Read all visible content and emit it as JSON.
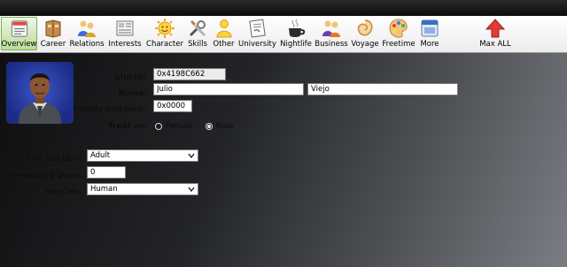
{
  "toolbar": {
    "items": [
      {
        "label": "Overview",
        "icon": "overview-icon",
        "active": true
      },
      {
        "label": "Career",
        "icon": "career-icon"
      },
      {
        "label": "Relations",
        "icon": "relations-icon"
      },
      {
        "label": "Interests",
        "icon": "interests-icon"
      },
      {
        "label": "Character",
        "icon": "character-icon"
      },
      {
        "label": "Skills",
        "icon": "skills-icon"
      },
      {
        "label": "Other",
        "icon": "other-icon"
      },
      {
        "label": "University",
        "icon": "university-icon"
      },
      {
        "label": "Nightlife",
        "icon": "nightlife-icon"
      },
      {
        "label": "Business",
        "icon": "business-icon"
      },
      {
        "label": "Voyage",
        "icon": "voyage-icon"
      },
      {
        "label": "Freetime",
        "icon": "freetime-icon"
      },
      {
        "label": "More",
        "icon": "more-icon"
      },
      {
        "label": "Max ALL",
        "icon": "max-all-icon"
      }
    ]
  },
  "form": {
    "sim_id_label": "Sim ID:",
    "sim_id_value": "0x4198C662",
    "name_label": "Name:",
    "first_name": "Julio",
    "last_name": "Viejo",
    "family_label": "Family Instance:",
    "family_value": "0x0000",
    "treat_label": "Treat as:",
    "female_label": "Female",
    "male_label": "Male",
    "selected_gender": "Male",
    "life_section_label": "Life Section:",
    "life_section_value": "Adult",
    "remaining_days_label": "Remaining Days:",
    "remaining_days_value": "0",
    "species_label": "Species:",
    "species_value": "Human"
  },
  "colors": {
    "active_tab": "#b9dc9a",
    "portrait_bg": "#2a40b0",
    "max_all_arrow": "#e23a3a"
  }
}
